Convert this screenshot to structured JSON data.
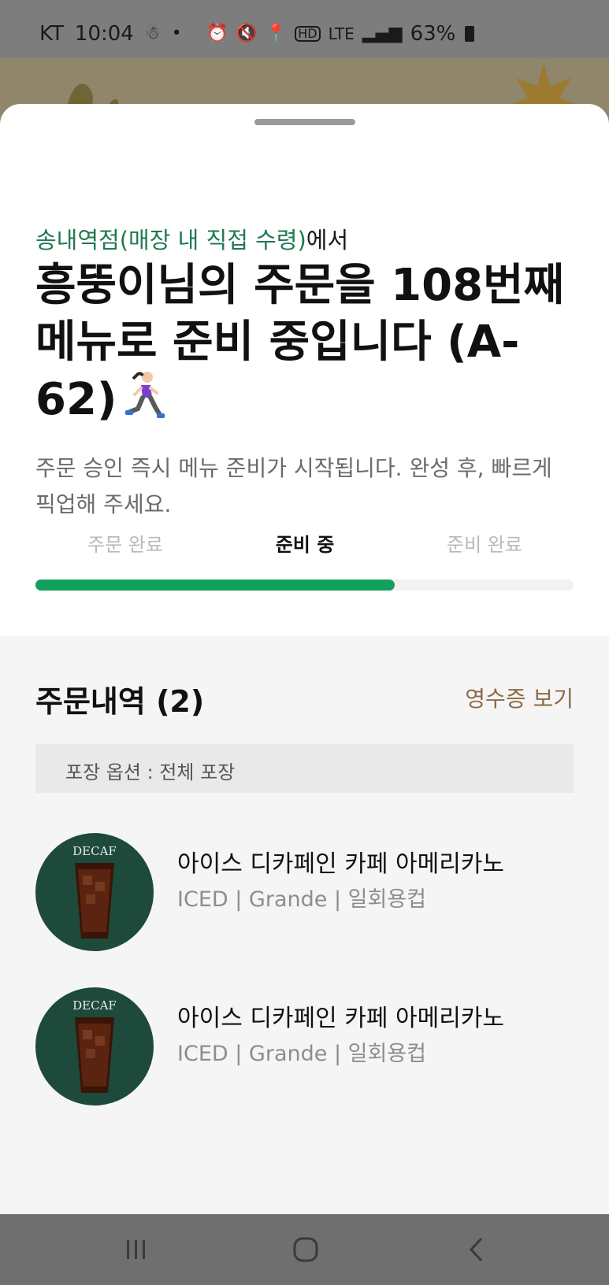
{
  "status_bar": {
    "carrier": "KT",
    "time": "10:04",
    "network": "LTE",
    "battery": "63%"
  },
  "sheet": {
    "store_name": "송내역점(매장 내 직접 수령)",
    "store_suffix": "에서",
    "headline": "흥뚱이님의 주문을 108번째 메뉴로 준비 중입니다 (A-62)",
    "description": "주문 승인 즉시 메뉴 준비가 시작됩니다. 완성 후, 빠르게 픽업해 주세요.",
    "steps": [
      "주문 완료",
      "준비 중",
      "준비 완료"
    ],
    "active_step": 1,
    "progress": 0.667
  },
  "order": {
    "title": "주문내역 (2)",
    "receipt_link": "영수증 보기",
    "pack_option": "포장 옵션 : 전체 포장",
    "items": [
      {
        "name": "아이스 디카페인 카페 아메리카노",
        "options": "ICED | Grande | 일회용컵",
        "badge": "DECAF"
      },
      {
        "name": "아이스 디카페인 카페 아메리카노",
        "options": "ICED | Grande | 일회용컵",
        "badge": "DECAF"
      }
    ]
  },
  "colors": {
    "accent_green": "#12a05c",
    "store_green": "#1f7a4f",
    "receipt_brown": "#8a6a44",
    "thumb_green": "#1d4a3a"
  },
  "icons": {
    "runner": "woman-running-emoji",
    "nav": [
      "recent-apps-icon",
      "home-icon",
      "back-icon"
    ]
  }
}
